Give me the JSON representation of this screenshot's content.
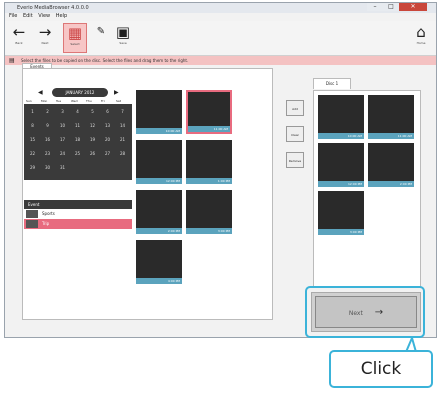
{
  "window": {
    "title": "Everio MediaBrowser 4.0.0.0"
  },
  "window_controls": {
    "minimize": "–",
    "maximize": "□",
    "close": "✕"
  },
  "menu": [
    "File",
    "Edit",
    "View",
    "Help"
  ],
  "toolbar": {
    "back": "Back",
    "next": "Next",
    "select": "Select",
    "save": "Save",
    "home": "Home"
  },
  "infobar": {
    "text": "Select the files to be copied on the disc. Select the files and drag them to the right."
  },
  "left_tab": "Events",
  "calendar": {
    "month": "JANUARY 2012",
    "weekdays": [
      "Sun",
      "Mon",
      "Tue",
      "Wed",
      "Thu",
      "Fri",
      "Sat"
    ],
    "weeks": [
      [
        "1",
        "2",
        "3",
        "4",
        "5",
        "6",
        "7"
      ],
      [
        "8",
        "9",
        "10",
        "11",
        "12",
        "13",
        "14"
      ],
      [
        "15",
        "16",
        "17",
        "18",
        "19",
        "20",
        "21"
      ],
      [
        "22",
        "23",
        "24",
        "25",
        "26",
        "27",
        "28"
      ],
      [
        "29",
        "30",
        "31",
        "",
        "",
        "",
        ""
      ]
    ]
  },
  "event_list": {
    "header": "Event",
    "items": [
      "Sports",
      "Trip"
    ]
  },
  "thumbnails": [
    {
      "time": "10:00 AM"
    },
    {
      "time": "11:00 AM"
    },
    {
      "time": "12:00 PM"
    },
    {
      "time": "1:00 PM"
    },
    {
      "time": "2:00 PM"
    },
    {
      "time": "3:00 PM"
    },
    {
      "time": "4:00 PM"
    }
  ],
  "mid_controls": [
    "Add",
    "Clear",
    "Remove"
  ],
  "right_tab": "Disc 1",
  "right_thumbs": [
    {
      "time": "10:00 AM"
    },
    {
      "time": "11:00 AM"
    },
    {
      "time": "12:00 PM"
    },
    {
      "time": "2:00 PM"
    },
    {
      "time": "3:00 PM"
    }
  ],
  "next_button": {
    "label": "Next",
    "arrow": "→"
  },
  "callout": {
    "label": "Click"
  },
  "colors": {
    "accent_pink": "#e86b7f",
    "thumb_bar": "#5ba3bd",
    "callout_border": "#3bb3d9"
  }
}
